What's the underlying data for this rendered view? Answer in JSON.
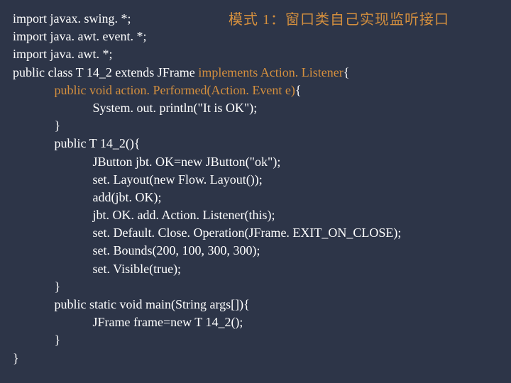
{
  "title": "模式 1：窗口类自己实现监听接口",
  "code": {
    "l1a": "import javax. swing. *;",
    "l2a": "import java. awt. event. *;",
    "l3a": "import java. awt. *;",
    "l4a": "public class T 14_2 extends JFrame ",
    "l4b": "implements Action. Listener",
    "l4c": "{",
    "l5a": "public void action. Performed(Action. Event e)",
    "l5b": "{",
    "l6a": "System. out. println(\"It is OK\");",
    "l7a": "}",
    "l8a": "public T 14_2(){",
    "l9a": "JButton jbt. OK=new JButton(\"ok\");",
    "l10a": "set. Layout(new Flow. Layout());",
    "l11a": "add(jbt. OK);",
    "l12a": "jbt. OK. add. Action. Listener(this);",
    "l13a": "set. Default. Close. Operation(JFrame. EXIT_ON_CLOSE);",
    "l14a": "set. Bounds(200, 100, 300, 300);",
    "l15a": "set. Visible(true);",
    "l16a": "}",
    "l17a": "public static void main(String args[]){",
    "l18a": "JFrame frame=new T 14_2();",
    "l19a": "}",
    "l20a": "}"
  }
}
